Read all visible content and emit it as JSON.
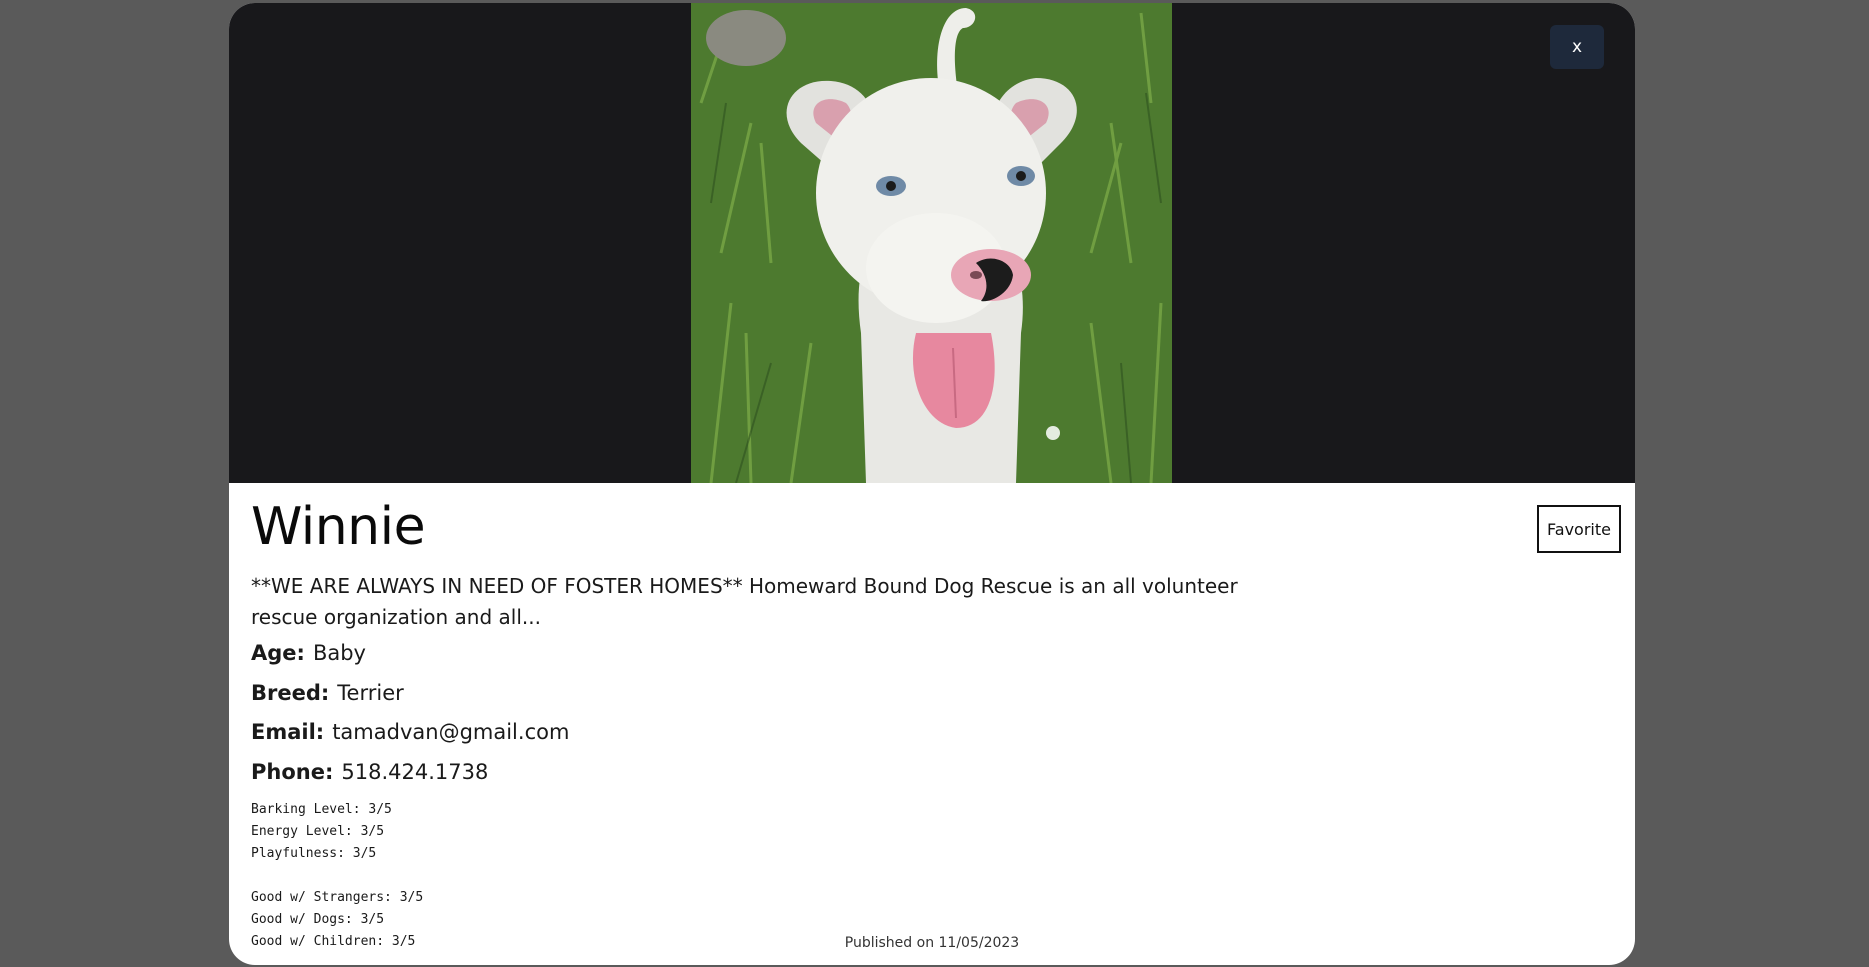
{
  "modal": {
    "close_label": "x",
    "favorite_label": "Favorite"
  },
  "pet": {
    "name": "Winnie",
    "description": "**WE ARE ALWAYS IN NEED OF FOSTER HOMES** Homeward Bound Dog Rescue is an all volunteer rescue organization and all...",
    "age_label": "Age:",
    "age": "Baby",
    "breed_label": "Breed:",
    "breed": "Terrier",
    "email_label": "Email:",
    "email": "tamadvan@gmail.com",
    "phone_label": "Phone:",
    "phone": "518.424.1738",
    "traits": [
      "Barking Level: 3/5",
      "Energy Level: 3/5",
      "Playfulness: 3/5",
      "Good w/ Strangers: 3/5",
      "Good w/ Dogs: 3/5",
      "Good w/ Children: 3/5"
    ],
    "published": "Published on 11/05/2023"
  },
  "colors": {
    "overlay": "#5a5a5a",
    "image_backdrop": "#18181b",
    "close_button": "#1e293b"
  }
}
